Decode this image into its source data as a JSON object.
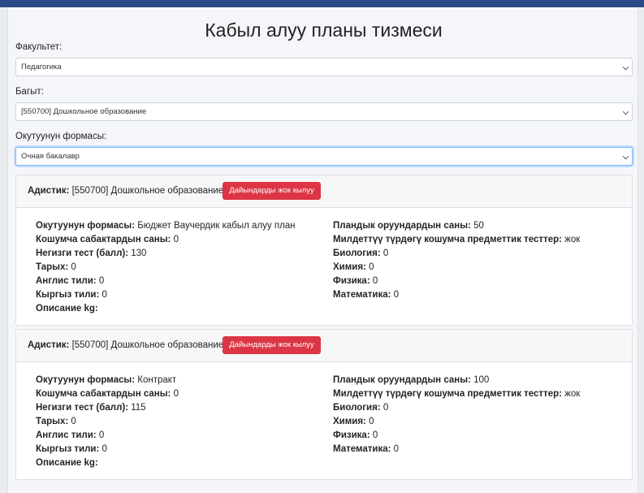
{
  "page": {
    "title": "Кабыл алуу планы тизмеси"
  },
  "filters": {
    "faculty": {
      "label": "Факультет:",
      "value": "Педагогика"
    },
    "direction": {
      "label": "Багыт:",
      "value": "[550700] Дошкольное образование"
    },
    "study_form": {
      "label": "Окутуунун формасы:",
      "value": "Очная бакалавр"
    }
  },
  "labels": {
    "specialty": "Адистик:",
    "delete_button": "Дайындарды жок кылуу",
    "study_form": "Окутуунун формасы:",
    "additional_subjects": "Кошумча сабактардын саны:",
    "main_test": "Негизги тест (балл):",
    "history": "Тарых:",
    "english": "Англис тили:",
    "kyrgyz": "Кыргыз тили:",
    "description": "Описание kg:",
    "planned_seats": "Пландык оруундардын саны:",
    "mandatory_tests": "Милдеттүү түрдөгү кошумча предметтик тесттер:",
    "biology": "Биология:",
    "chemistry": "Химия:",
    "physics": "Физика:",
    "math": "Математика:"
  },
  "cards": [
    {
      "specialty": "[550700] Дошкольное образование",
      "study_form": "Бюджет Ваучердик кабыл алуу план",
      "additional_subjects": "0",
      "main_test": "130",
      "history": "0",
      "english": "0",
      "kyrgyz": "0",
      "description": "",
      "planned_seats": "50",
      "mandatory_tests": "жок",
      "biology": "0",
      "chemistry": "0",
      "physics": "0",
      "math": "0"
    },
    {
      "specialty": "[550700] Дошкольное образование",
      "study_form": "Контракт",
      "additional_subjects": "0",
      "main_test": "115",
      "history": "0",
      "english": "0",
      "kyrgyz": "0",
      "description": "",
      "planned_seats": "100",
      "mandatory_tests": "жок",
      "biology": "0",
      "chemistry": "0",
      "physics": "0",
      "math": "0"
    }
  ]
}
